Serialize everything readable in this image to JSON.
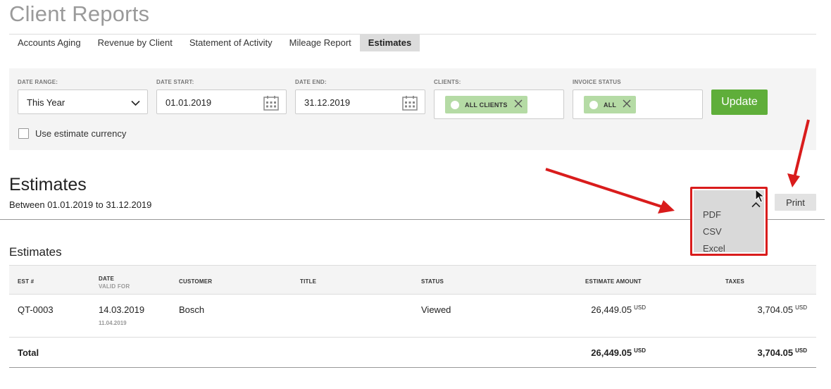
{
  "page": {
    "title": "Client Reports"
  },
  "tabs": [
    {
      "label": "Accounts Aging"
    },
    {
      "label": "Revenue by Client"
    },
    {
      "label": "Statement of Activity"
    },
    {
      "label": "Mileage Report"
    },
    {
      "label": "Estimates",
      "active": true
    }
  ],
  "filters": {
    "date_range": {
      "label": "DATE RANGE:",
      "value": "This Year"
    },
    "date_start": {
      "label": "DATE START:",
      "value": "01.01.2019"
    },
    "date_end": {
      "label": "DATE END:",
      "value": "31.12.2019"
    },
    "clients": {
      "label": "CLIENTS:",
      "chip": "ALL CLIENTS"
    },
    "invoice_status": {
      "label": "INVOICE STATUS",
      "chip": "ALL"
    },
    "update_label": "Update",
    "currency_checkbox": {
      "label": "Use estimate currency",
      "checked": false
    }
  },
  "report": {
    "heading": "Estimates",
    "subtitle": "Between 01.01.2019 to 31.12.2019",
    "table_heading": "Estimates"
  },
  "export_menu": {
    "open": true,
    "items": [
      "PDF",
      "CSV",
      "Excel"
    ],
    "highlight_color": "#d91c1c"
  },
  "print_label": "Print",
  "table": {
    "columns": {
      "est": "EST #",
      "date": "DATE",
      "date_sub": "VALID FOR",
      "customer": "CUSTOMER",
      "title": "TITLE",
      "status": "STATUS",
      "amount": "ESTIMATE AMOUNT",
      "taxes": "TAXES"
    },
    "rows": [
      {
        "est": "QT-0003",
        "date": "14.03.2019",
        "valid_for": "11.04.2019",
        "customer": "Bosch",
        "title": "",
        "status": "Viewed",
        "amount": "26,449.05",
        "amount_currency": "USD",
        "taxes": "3,704.05",
        "taxes_currency": "USD"
      }
    ],
    "total": {
      "label": "Total",
      "amount": "26,449.05",
      "amount_currency": "USD",
      "taxes": "3,704.05",
      "taxes_currency": "USD"
    }
  },
  "colors": {
    "accent_green": "#5fae3a",
    "chip_green": "#b5dba5",
    "annotation_red": "#d91c1c"
  }
}
